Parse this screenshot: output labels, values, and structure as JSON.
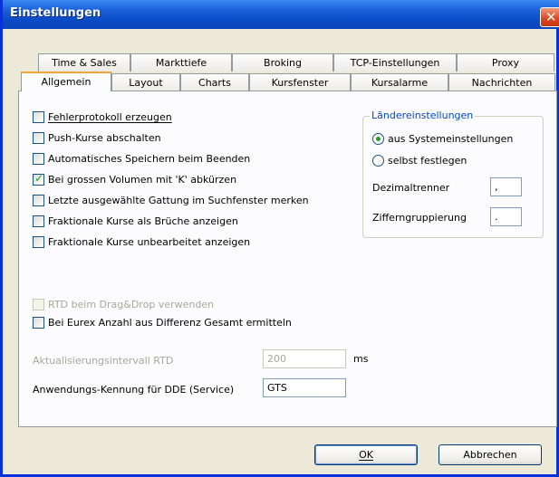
{
  "window": {
    "title": "Einstellungen",
    "close_glyph": "✕"
  },
  "tabs_back": [
    "Time & Sales",
    "Markttiefe",
    "Broking",
    "TCP-Einstellungen",
    "Proxy"
  ],
  "tabs_front": [
    "Allgemein",
    "Layout",
    "Charts",
    "Kursfenster",
    "Kursalarme",
    "Nachrichten"
  ],
  "active_tab": "Allgemein",
  "options": [
    {
      "label": "Fehlerprotokoll erzeugen",
      "checked": false
    },
    {
      "label": "Push-Kurse abschalten",
      "checked": false
    },
    {
      "label": "Automatisches Speichern beim Beenden",
      "checked": false
    },
    {
      "label": "Bei grossen Volumen mit 'K' abkürzen",
      "checked": true
    },
    {
      "label": "Letzte ausgewählte Gattung im Suchfenster merken",
      "checked": false
    },
    {
      "label": "Fraktionale Kurse als Brüche anzeigen",
      "checked": false
    },
    {
      "label": "Fraktionale Kurse unbearbeitet anzeigen",
      "checked": false
    }
  ],
  "rtd_option": {
    "label": "RTD beim Drag&Drop verwenden",
    "checked": false,
    "disabled": true
  },
  "eurex_option": {
    "label": "Bei Eurex Anzahl aus Differenz Gesamt ermitteln",
    "checked": false
  },
  "country": {
    "title": "Ländereinstellungen",
    "radio_system": "aus Systemeinstellungen",
    "radio_custom": "selbst festlegen",
    "selected": "aus Systemeinstellungen",
    "decimal_label": "Dezimaltrenner",
    "decimal_value": ",",
    "grouping_label": "Zifferngruppierung",
    "grouping_value": "."
  },
  "rtd_interval": {
    "label": "Aktualisierungsintervall RTD",
    "value": "200",
    "unit": "ms"
  },
  "dde": {
    "label": "Anwendungs-Kennung für DDE (Service)",
    "value": "GTS"
  },
  "buttons": {
    "ok": "OK",
    "cancel": "Abbrechen"
  }
}
